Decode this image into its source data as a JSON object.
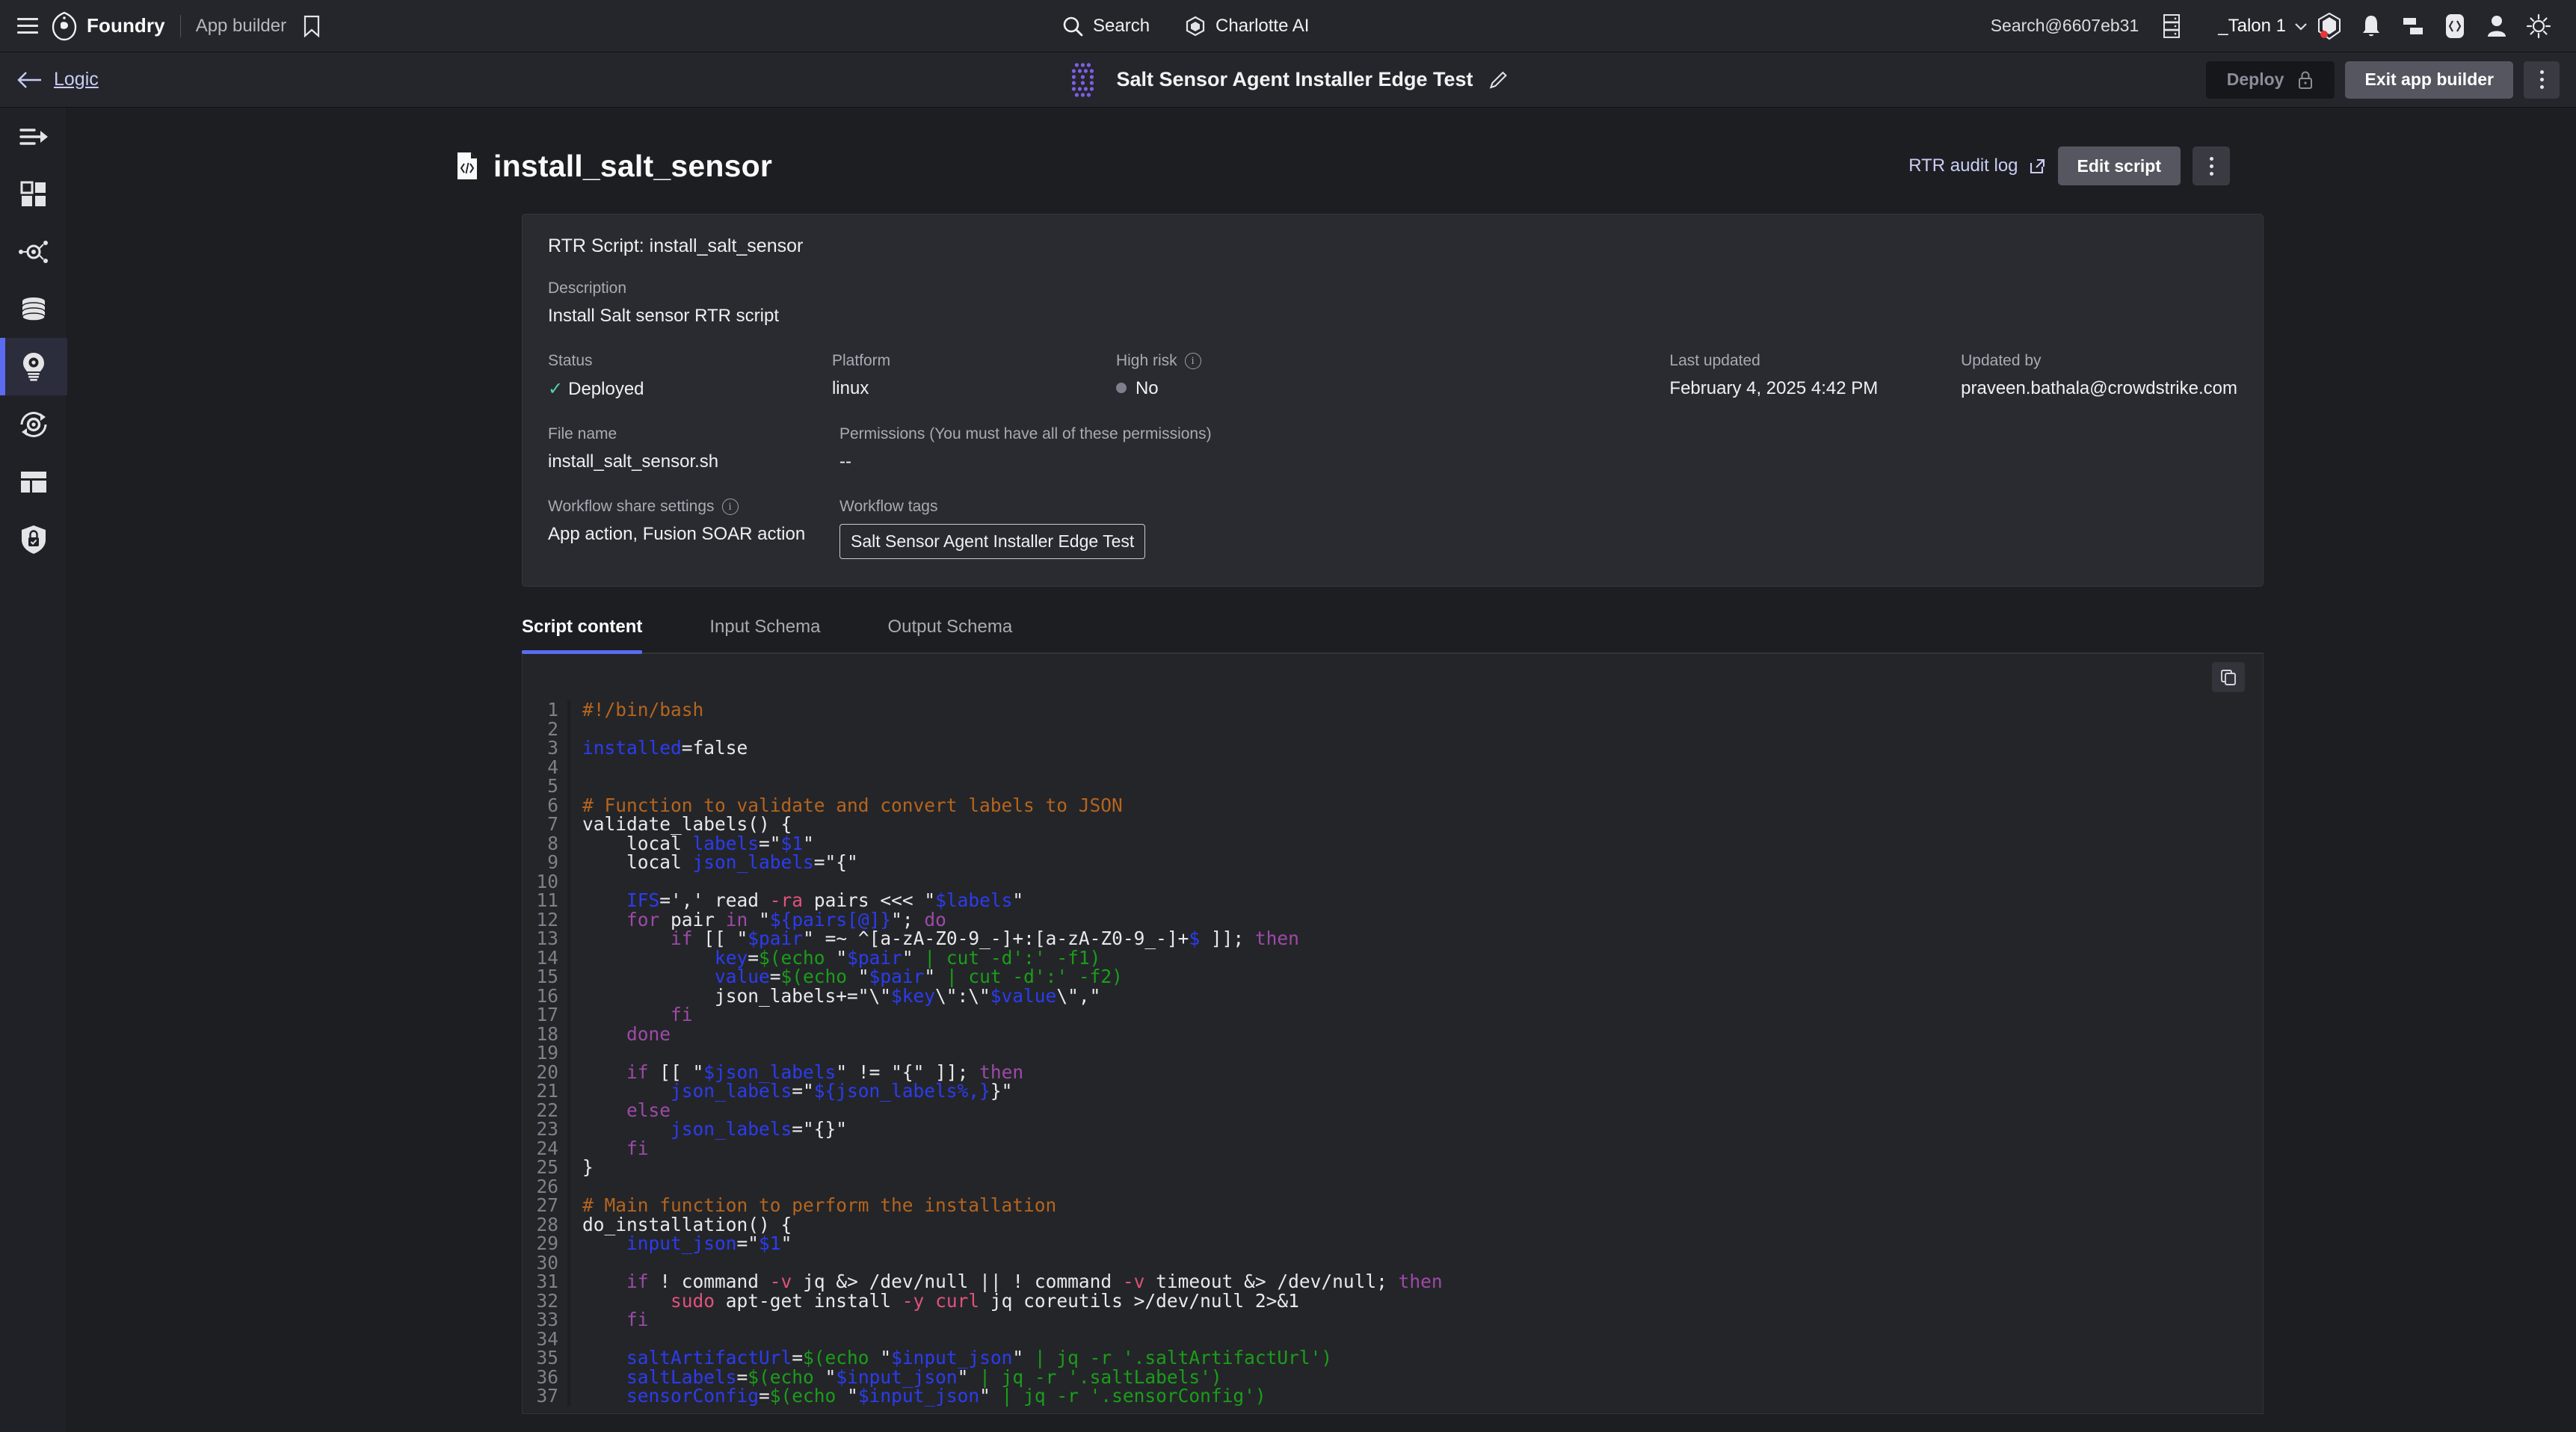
{
  "topbar": {
    "menu_icon": "hamburger-icon",
    "brand": "Foundry",
    "app_builder_label": "App builder",
    "bookmark_icon": "bookmark-icon",
    "search_label": "Search",
    "search_icon": "search-icon",
    "charlotte_label": "Charlotte AI",
    "charlotte_icon": "charlotte-ai-icon",
    "tenant": "Search@6607eb31",
    "grid_icon": "server-grid-icon",
    "talon_label": "_Talon 1",
    "chevron_icon": "chevron-down-icon",
    "icons": [
      "alert-shield-icon",
      "bell-icon",
      "chat-icon",
      "code-brackets-icon",
      "user-avatar-icon",
      "theme-sun-icon"
    ]
  },
  "subbar": {
    "back_icon": "arrow-left-icon",
    "back_label": "Logic",
    "app_icon": "dot-grid-icon",
    "app_title": "Salt Sensor Agent Installer Edge Test",
    "edit_icon": "pencil-icon",
    "deploy_label": "Deploy",
    "deploy_lock_icon": "lock-icon",
    "exit_label": "Exit app builder",
    "kebab_icon": "kebab-menu-icon"
  },
  "rail": {
    "items": [
      {
        "name": "data-flow",
        "icon": "arrow-lines-icon",
        "active": false
      },
      {
        "name": "dashboards",
        "icon": "grid-squares-icon",
        "active": false
      },
      {
        "name": "integrations",
        "icon": "node-gear-icon",
        "active": false
      },
      {
        "name": "data-store",
        "icon": "database-icon",
        "active": false
      },
      {
        "name": "logic",
        "icon": "lightbulb-gear-icon",
        "active": true
      },
      {
        "name": "workflows",
        "icon": "gear-refresh-icon",
        "active": false
      },
      {
        "name": "ui-layout",
        "icon": "layout-icon",
        "active": false
      },
      {
        "name": "permissions",
        "icon": "shield-lock-icon",
        "active": false
      }
    ]
  },
  "page": {
    "title": "install_salt_sensor",
    "title_icon": "script-file-icon",
    "audit_log_label": "RTR audit log",
    "audit_log_icon": "external-link-icon",
    "edit_script_label": "Edit script",
    "kebab_icon": "kebab-menu-icon"
  },
  "card": {
    "heading": "RTR Script: install_salt_sensor",
    "description_label": "Description",
    "description_value": "Install Salt sensor RTR script",
    "status_label": "Status",
    "status_value": "Deployed",
    "status_check_icon": "check-icon",
    "platform_label": "Platform",
    "platform_value": "linux",
    "high_risk_label": "High risk",
    "high_risk_info_icon": "info-icon",
    "high_risk_value": "No",
    "last_updated_label": "Last updated",
    "last_updated_value": "February 4, 2025 4:42 PM",
    "updated_by_label": "Updated by",
    "updated_by_value": "praveen.bathala@crowdstrike.com",
    "file_name_label": "File name",
    "file_name_value": "install_salt_sensor.sh",
    "permissions_label": "Permissions (You must have all of these permissions)",
    "permissions_value": "--",
    "share_settings_label": "Workflow share settings",
    "share_settings_info_icon": "info-icon",
    "share_settings_value": "App action, Fusion SOAR action",
    "workflow_tags_label": "Workflow tags",
    "workflow_tag_value": "Salt Sensor Agent Installer Edge Test"
  },
  "tabs": [
    {
      "label": "Script content",
      "active": true
    },
    {
      "label": "Input Schema",
      "active": false
    },
    {
      "label": "Output Schema",
      "active": false
    }
  ],
  "code": {
    "copy_icon": "copy-icon",
    "language": "bash",
    "lines": [
      {
        "n": 1,
        "tokens": [
          {
            "t": "cmt",
            "s": "#!/bin/bash"
          }
        ]
      },
      {
        "n": 2,
        "tokens": []
      },
      {
        "n": 3,
        "tokens": [
          {
            "t": "var",
            "s": "installed"
          },
          {
            "t": "pln",
            "s": "=false"
          }
        ]
      },
      {
        "n": 4,
        "tokens": []
      },
      {
        "n": 5,
        "tokens": []
      },
      {
        "n": 6,
        "tokens": [
          {
            "t": "cmt",
            "s": "# Function to validate and convert labels to JSON"
          }
        ]
      },
      {
        "n": 7,
        "tokens": [
          {
            "t": "pln",
            "s": "validate_labels() {"
          }
        ]
      },
      {
        "n": 8,
        "tokens": [
          {
            "t": "pln",
            "s": "    local "
          },
          {
            "t": "var",
            "s": "labels"
          },
          {
            "t": "pln",
            "s": "=\""
          },
          {
            "t": "var",
            "s": "$1"
          },
          {
            "t": "pln",
            "s": "\""
          }
        ]
      },
      {
        "n": 9,
        "tokens": [
          {
            "t": "pln",
            "s": "    local "
          },
          {
            "t": "var",
            "s": "json_labels"
          },
          {
            "t": "pln",
            "s": "=\"{\""
          }
        ]
      },
      {
        "n": 10,
        "tokens": []
      },
      {
        "n": 11,
        "tokens": [
          {
            "t": "pln",
            "s": "    "
          },
          {
            "t": "var",
            "s": "IFS"
          },
          {
            "t": "pln",
            "s": "=',' read "
          },
          {
            "t": "flg",
            "s": "-ra"
          },
          {
            "t": "pln",
            "s": " pairs <<< \""
          },
          {
            "t": "var",
            "s": "$labels"
          },
          {
            "t": "pln",
            "s": "\""
          }
        ]
      },
      {
        "n": 12,
        "tokens": [
          {
            "t": "pln",
            "s": "    "
          },
          {
            "t": "kw",
            "s": "for"
          },
          {
            "t": "pln",
            "s": " pair "
          },
          {
            "t": "kw",
            "s": "in"
          },
          {
            "t": "pln",
            "s": " \""
          },
          {
            "t": "var",
            "s": "${pairs[@]}"
          },
          {
            "t": "pln",
            "s": "\"; "
          },
          {
            "t": "kw",
            "s": "do"
          }
        ]
      },
      {
        "n": 13,
        "tokens": [
          {
            "t": "pln",
            "s": "        "
          },
          {
            "t": "kw",
            "s": "if"
          },
          {
            "t": "pln",
            "s": " [[ \""
          },
          {
            "t": "var",
            "s": "$pair"
          },
          {
            "t": "pln",
            "s": "\" =~ ^[a-zA-Z0-9_-]+:[a-zA-Z0-9_-]+"
          },
          {
            "t": "var",
            "s": "$"
          },
          {
            "t": "pln",
            "s": " ]]; "
          },
          {
            "t": "kw",
            "s": "then"
          }
        ]
      },
      {
        "n": 14,
        "tokens": [
          {
            "t": "pln",
            "s": "            "
          },
          {
            "t": "var",
            "s": "key"
          },
          {
            "t": "pln",
            "s": "="
          },
          {
            "t": "sub",
            "s": "$(echo "
          },
          {
            "t": "pln",
            "s": "\""
          },
          {
            "t": "var",
            "s": "$pair"
          },
          {
            "t": "pln",
            "s": "\""
          },
          {
            "t": "sub",
            "s": " | cut -d':' -f1)"
          }
        ]
      },
      {
        "n": 15,
        "tokens": [
          {
            "t": "pln",
            "s": "            "
          },
          {
            "t": "var",
            "s": "value"
          },
          {
            "t": "pln",
            "s": "="
          },
          {
            "t": "sub",
            "s": "$(echo "
          },
          {
            "t": "pln",
            "s": "\""
          },
          {
            "t": "var",
            "s": "$pair"
          },
          {
            "t": "pln",
            "s": "\""
          },
          {
            "t": "sub",
            "s": " | cut -d':' -f2)"
          }
        ]
      },
      {
        "n": 16,
        "tokens": [
          {
            "t": "pln",
            "s": "            json_labels+=\"\\\""
          },
          {
            "t": "var",
            "s": "$key"
          },
          {
            "t": "pln",
            "s": "\\\":\\\""
          },
          {
            "t": "var",
            "s": "$value"
          },
          {
            "t": "pln",
            "s": "\\\",\""
          }
        ]
      },
      {
        "n": 17,
        "tokens": [
          {
            "t": "pln",
            "s": "        "
          },
          {
            "t": "kw",
            "s": "fi"
          }
        ]
      },
      {
        "n": 18,
        "tokens": [
          {
            "t": "pln",
            "s": "    "
          },
          {
            "t": "kw",
            "s": "done"
          }
        ]
      },
      {
        "n": 19,
        "tokens": []
      },
      {
        "n": 20,
        "tokens": [
          {
            "t": "pln",
            "s": "    "
          },
          {
            "t": "kw",
            "s": "if"
          },
          {
            "t": "pln",
            "s": " [[ \""
          },
          {
            "t": "var",
            "s": "$json_labels"
          },
          {
            "t": "pln",
            "s": "\" != \"{\" ]]; "
          },
          {
            "t": "kw",
            "s": "then"
          }
        ]
      },
      {
        "n": 21,
        "tokens": [
          {
            "t": "pln",
            "s": "        "
          },
          {
            "t": "var",
            "s": "json_labels"
          },
          {
            "t": "pln",
            "s": "=\""
          },
          {
            "t": "var",
            "s": "${json_labels%,}"
          },
          {
            "t": "pln",
            "s": "}\""
          }
        ]
      },
      {
        "n": 22,
        "tokens": [
          {
            "t": "pln",
            "s": "    "
          },
          {
            "t": "kw",
            "s": "else"
          }
        ]
      },
      {
        "n": 23,
        "tokens": [
          {
            "t": "pln",
            "s": "        "
          },
          {
            "t": "var",
            "s": "json_labels"
          },
          {
            "t": "pln",
            "s": "=\"{}\""
          }
        ]
      },
      {
        "n": 24,
        "tokens": [
          {
            "t": "pln",
            "s": "    "
          },
          {
            "t": "kw",
            "s": "fi"
          }
        ]
      },
      {
        "n": 25,
        "tokens": [
          {
            "t": "pln",
            "s": "}"
          }
        ]
      },
      {
        "n": 26,
        "tokens": []
      },
      {
        "n": 27,
        "tokens": [
          {
            "t": "cmt",
            "s": "# Main function to perform the installation"
          }
        ]
      },
      {
        "n": 28,
        "tokens": [
          {
            "t": "pln",
            "s": "do_installation() {"
          }
        ]
      },
      {
        "n": 29,
        "tokens": [
          {
            "t": "pln",
            "s": "    "
          },
          {
            "t": "var",
            "s": "input_json"
          },
          {
            "t": "pln",
            "s": "=\""
          },
          {
            "t": "var",
            "s": "$1"
          },
          {
            "t": "pln",
            "s": "\""
          }
        ]
      },
      {
        "n": 30,
        "tokens": []
      },
      {
        "n": 31,
        "tokens": [
          {
            "t": "pln",
            "s": "    "
          },
          {
            "t": "kw",
            "s": "if"
          },
          {
            "t": "pln",
            "s": " ! command "
          },
          {
            "t": "flg",
            "s": "-v"
          },
          {
            "t": "pln",
            "s": " jq &> /dev/null || ! command "
          },
          {
            "t": "flg",
            "s": "-v"
          },
          {
            "t": "pln",
            "s": " timeout &> /dev/null; "
          },
          {
            "t": "kw",
            "s": "then"
          }
        ]
      },
      {
        "n": 32,
        "tokens": [
          {
            "t": "pln",
            "s": "        "
          },
          {
            "t": "flg",
            "s": "sudo"
          },
          {
            "t": "pln",
            "s": " apt-get install "
          },
          {
            "t": "flg",
            "s": "-y"
          },
          {
            "t": "pln",
            "s": " "
          },
          {
            "t": "flg",
            "s": "curl"
          },
          {
            "t": "pln",
            "s": " jq coreutils >/dev/null 2>&1"
          }
        ]
      },
      {
        "n": 33,
        "tokens": [
          {
            "t": "pln",
            "s": "    "
          },
          {
            "t": "kw",
            "s": "fi"
          }
        ]
      },
      {
        "n": 34,
        "tokens": []
      },
      {
        "n": 35,
        "tokens": [
          {
            "t": "pln",
            "s": "    "
          },
          {
            "t": "var",
            "s": "saltArtifactUrl"
          },
          {
            "t": "pln",
            "s": "="
          },
          {
            "t": "sub",
            "s": "$(echo "
          },
          {
            "t": "pln",
            "s": "\""
          },
          {
            "t": "var",
            "s": "$input_json"
          },
          {
            "t": "pln",
            "s": "\""
          },
          {
            "t": "sub",
            "s": " | jq -r '.saltArtifactUrl')"
          }
        ]
      },
      {
        "n": 36,
        "tokens": [
          {
            "t": "pln",
            "s": "    "
          },
          {
            "t": "var",
            "s": "saltLabels"
          },
          {
            "t": "pln",
            "s": "="
          },
          {
            "t": "sub",
            "s": "$(echo "
          },
          {
            "t": "pln",
            "s": "\""
          },
          {
            "t": "var",
            "s": "$input_json"
          },
          {
            "t": "pln",
            "s": "\""
          },
          {
            "t": "sub",
            "s": " | jq -r '.saltLabels')"
          }
        ]
      },
      {
        "n": 37,
        "tokens": [
          {
            "t": "pln",
            "s": "    "
          },
          {
            "t": "var",
            "s": "sensorConfig"
          },
          {
            "t": "pln",
            "s": "="
          },
          {
            "t": "sub",
            "s": "$(echo "
          },
          {
            "t": "pln",
            "s": "\""
          },
          {
            "t": "var",
            "s": "$input_json"
          },
          {
            "t": "pln",
            "s": "\""
          },
          {
            "t": "sub",
            "s": " | jq -r '.sensorConfig')"
          }
        ]
      }
    ]
  },
  "colors": {
    "accent": "#5b6cf0",
    "link": "#c9cdf5",
    "bg": "#1d1e22",
    "panel": "#2a2b31",
    "code_bg": "#242529",
    "status_ok": "#4fd6a4",
    "comment": "#b5651d",
    "variable": "#2b3cf0",
    "keyword": "#9d4aa8",
    "subshell": "#1a9e1a",
    "flag": "#e0527a"
  }
}
